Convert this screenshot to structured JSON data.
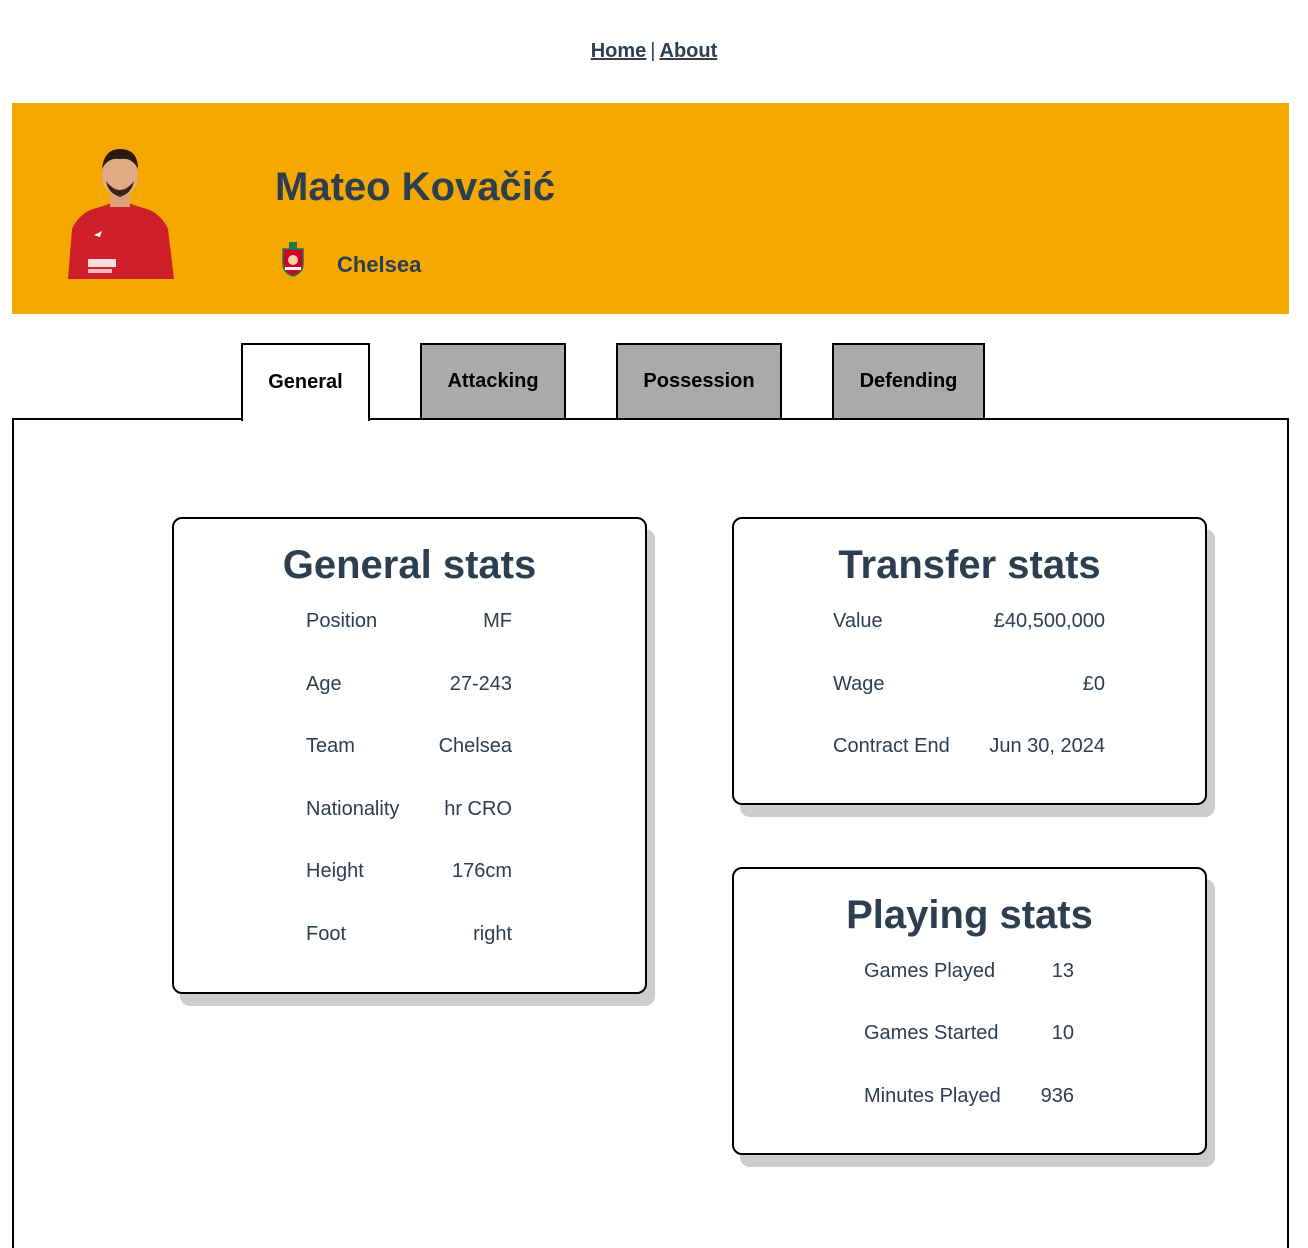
{
  "nav": {
    "home": "Home",
    "separator": "|",
    "about": "About"
  },
  "player": {
    "name": "Mateo Kovačić",
    "club": "Chelsea",
    "photo_icon": "player-photo",
    "crest_icon": "club-crest"
  },
  "colors": {
    "banner": "#f5a800",
    "text": "#2c3e50",
    "tab_inactive": "#aaaaaa"
  },
  "tabs": [
    {
      "label": "General",
      "active": true
    },
    {
      "label": "Attacking",
      "active": false
    },
    {
      "label": "Possession",
      "active": false
    },
    {
      "label": "Defending",
      "active": false
    }
  ],
  "general": {
    "title": "General stats",
    "rows": [
      {
        "k": "Position",
        "v": "MF"
      },
      {
        "k": "Age",
        "v": "27-243"
      },
      {
        "k": "Team",
        "v": "Chelsea"
      },
      {
        "k": "Nationality",
        "v": "hr CRO"
      },
      {
        "k": "Height",
        "v": "176cm"
      },
      {
        "k": "Foot",
        "v": "right"
      }
    ]
  },
  "transfer": {
    "title": "Transfer stats",
    "rows": [
      {
        "k": "Value",
        "v": "£40,500,000"
      },
      {
        "k": "Wage",
        "v": "£0"
      },
      {
        "k": "Contract End",
        "v": "Jun 30, 2024"
      }
    ]
  },
  "playing": {
    "title": "Playing stats",
    "rows": [
      {
        "k": "Games Played",
        "v": "13"
      },
      {
        "k": "Games Started",
        "v": "10"
      },
      {
        "k": "Minutes Played",
        "v": "936"
      }
    ]
  }
}
